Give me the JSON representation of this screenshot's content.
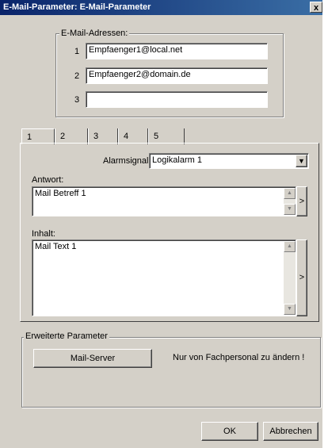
{
  "window": {
    "title": "E-Mail-Parameter: E-Mail-Parameter",
    "close_glyph": "x"
  },
  "email_group": {
    "legend": "E-Mail-Adressen:",
    "rows": [
      {
        "num": "1",
        "value": "Empfaenger1@local.net"
      },
      {
        "num": "2",
        "value": "Empfaenger2@domain.de"
      },
      {
        "num": "3",
        "value": ""
      }
    ]
  },
  "tabs": [
    "1",
    "2",
    "3",
    "4",
    "5"
  ],
  "selected_tab": "1",
  "alarm": {
    "label": "Alarmsignal:",
    "value": "Logikalarm 1"
  },
  "answer": {
    "label": "Antwort:",
    "value": "Mail Betreff 1",
    "arrow": ">"
  },
  "content": {
    "label": "Inhalt:",
    "value": "Mail Text 1",
    "arrow": ">"
  },
  "advanced": {
    "legend": "Erweiterte Parameter",
    "mail_server_button": "Mail-Server",
    "note": "Nur von Fachpersonal zu ändern !"
  },
  "footer": {
    "ok_label": "OK",
    "cancel_label": "Abbrechen"
  }
}
